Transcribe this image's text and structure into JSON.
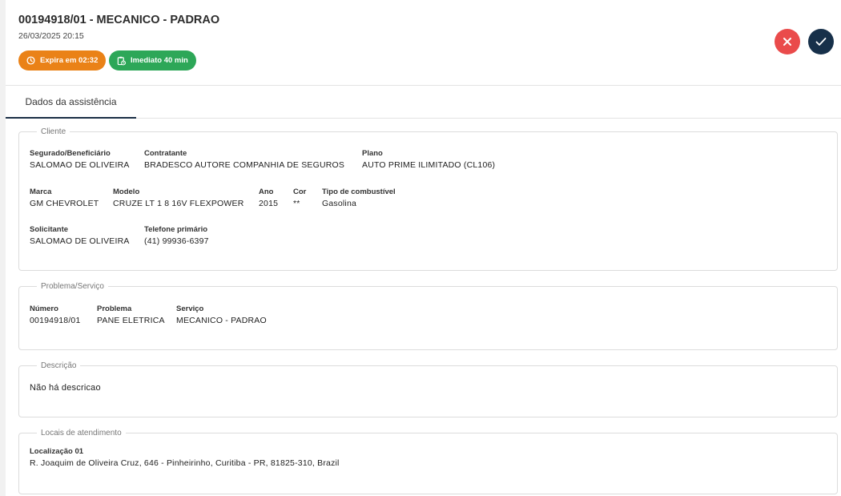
{
  "header": {
    "title": "00194918/01 - MECANICO - PADRAO",
    "datetime": "26/03/2025 20:15",
    "badge_expira": "Expira em 02:32",
    "badge_imediato": "Imediato 40 min",
    "icons": {
      "expira": "clock-icon",
      "imediato": "clipboard-clock-icon",
      "reject": "close-icon",
      "accept": "check-icon"
    },
    "colors": {
      "orange": "#ea8217",
      "green": "#2da758",
      "reject": "#ea4b4b",
      "accept": "#17304a"
    }
  },
  "tabs": [
    {
      "label": "Dados da assistência"
    }
  ],
  "cliente": {
    "legend": "Cliente",
    "segurado_label": "Segurado/Beneficiário",
    "segurado_value": "SALOMAO DE OLIVEIRA",
    "contratante_label": "Contratante",
    "contratante_value": "BRADESCO AUTORE COMPANHIA DE SEGUROS",
    "plano_label": "Plano",
    "plano_value": "AUTO PRIME ILIMITADO (CL106)",
    "marca_label": "Marca",
    "marca_value": "GM CHEVROLET",
    "modelo_label": "Modelo",
    "modelo_value": "CRUZE LT 1 8 16V FLEXPOWER",
    "ano_label": "Ano",
    "ano_value": "2015",
    "cor_label": "Cor",
    "cor_value": "**",
    "combustivel_label": "Tipo de combustível",
    "combustivel_value": "Gasolina",
    "solicitante_label": "Solicitante",
    "solicitante_value": "SALOMAO DE OLIVEIRA",
    "telefone_label": "Telefone primário",
    "telefone_value": "(41) 99936-6397"
  },
  "problema": {
    "legend": "Problema/Serviço",
    "numero_label": "Número",
    "numero_value": "00194918/01",
    "problema_label": "Problema",
    "problema_value": "PANE ELETRICA",
    "servico_label": "Serviço",
    "servico_value": "MECANICO - PADRAO"
  },
  "descricao": {
    "legend": "Descrição",
    "text": "Não há descricao"
  },
  "locais": {
    "legend": "Locais de atendimento",
    "localizacao_label": "Localização 01",
    "localizacao_value": "R. Joaquim de Oliveira Cruz, 646 - Pinheirinho, Curitiba - PR, 81825-310, Brazil"
  }
}
